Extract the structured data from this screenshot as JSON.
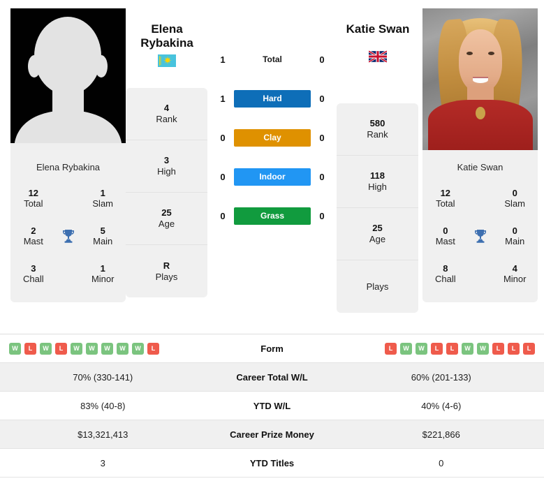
{
  "players": {
    "left": {
      "name_line1": "Elena",
      "name_line2": "Rybakina",
      "full_name": "Elena Rybakina",
      "flag": "kazakhstan-flag",
      "photo": "placeholder-avatar",
      "titles": {
        "total_value": "12",
        "total_label": "Total",
        "slam_value": "1",
        "slam_label": "Slam",
        "mast_value": "2",
        "mast_label": "Mast",
        "main_value": "5",
        "main_label": "Main",
        "chall_value": "3",
        "chall_label": "Chall",
        "minor_value": "1",
        "minor_label": "Minor"
      },
      "ranking": [
        {
          "value": "4",
          "label": "Rank"
        },
        {
          "value": "3",
          "label": "High"
        },
        {
          "value": "25",
          "label": "Age"
        },
        {
          "value": "R",
          "label": "Plays"
        }
      ],
      "form": [
        "W",
        "L",
        "W",
        "L",
        "W",
        "W",
        "W",
        "W",
        "W",
        "L"
      ]
    },
    "right": {
      "name_line1": "Katie Swan",
      "name_line2": "",
      "full_name": "Katie Swan",
      "flag": "united-kingdom-flag",
      "photo": "katie-swan-headshot",
      "titles": {
        "total_value": "12",
        "total_label": "Total",
        "slam_value": "0",
        "slam_label": "Slam",
        "mast_value": "0",
        "mast_label": "Mast",
        "main_value": "0",
        "main_label": "Main",
        "chall_value": "8",
        "chall_label": "Chall",
        "minor_value": "4",
        "minor_label": "Minor"
      },
      "ranking": [
        {
          "value": "580",
          "label": "Rank"
        },
        {
          "value": "118",
          "label": "High"
        },
        {
          "value": "25",
          "label": "Age"
        },
        {
          "value": "",
          "label": "Plays"
        }
      ],
      "form": [
        "L",
        "W",
        "W",
        "L",
        "L",
        "W",
        "W",
        "L",
        "L",
        "L"
      ]
    }
  },
  "h2h": [
    {
      "label": "Total",
      "left": "1",
      "right": "0",
      "chip": false,
      "color": ""
    },
    {
      "label": "Hard",
      "left": "1",
      "right": "0",
      "chip": true,
      "color": "#0e6eb8"
    },
    {
      "label": "Clay",
      "left": "0",
      "right": "0",
      "chip": true,
      "color": "#df9100"
    },
    {
      "label": "Indoor",
      "left": "0",
      "right": "0",
      "chip": true,
      "color": "#2196f3"
    },
    {
      "label": "Grass",
      "left": "0",
      "right": "0",
      "chip": true,
      "color": "#119b3e"
    }
  ],
  "table": [
    {
      "label": "Form",
      "left": "",
      "right": "",
      "is_form": true,
      "shaded": false
    },
    {
      "label": "Career Total W/L",
      "left": "70% (330-141)",
      "right": "60% (201-133)",
      "is_form": false,
      "shaded": true
    },
    {
      "label": "YTD W/L",
      "left": "83% (40-8)",
      "right": "40% (4-6)",
      "is_form": false,
      "shaded": false
    },
    {
      "label": "Career Prize Money",
      "left": "$13,321,413",
      "right": "$221,866",
      "is_form": false,
      "shaded": true
    },
    {
      "label": "YTD Titles",
      "left": "3",
      "right": "0",
      "is_form": false,
      "shaded": false
    }
  ],
  "colors": {
    "hard": "#0e6eb8",
    "clay": "#df9100",
    "indoor": "#2196f3",
    "grass": "#119b3e",
    "win": "#7bc47f",
    "loss": "#ef5b4c",
    "trophy": "#3d6fb0",
    "card_bg": "#f0f0f0"
  },
  "icons": {
    "trophy": "trophy-icon"
  }
}
